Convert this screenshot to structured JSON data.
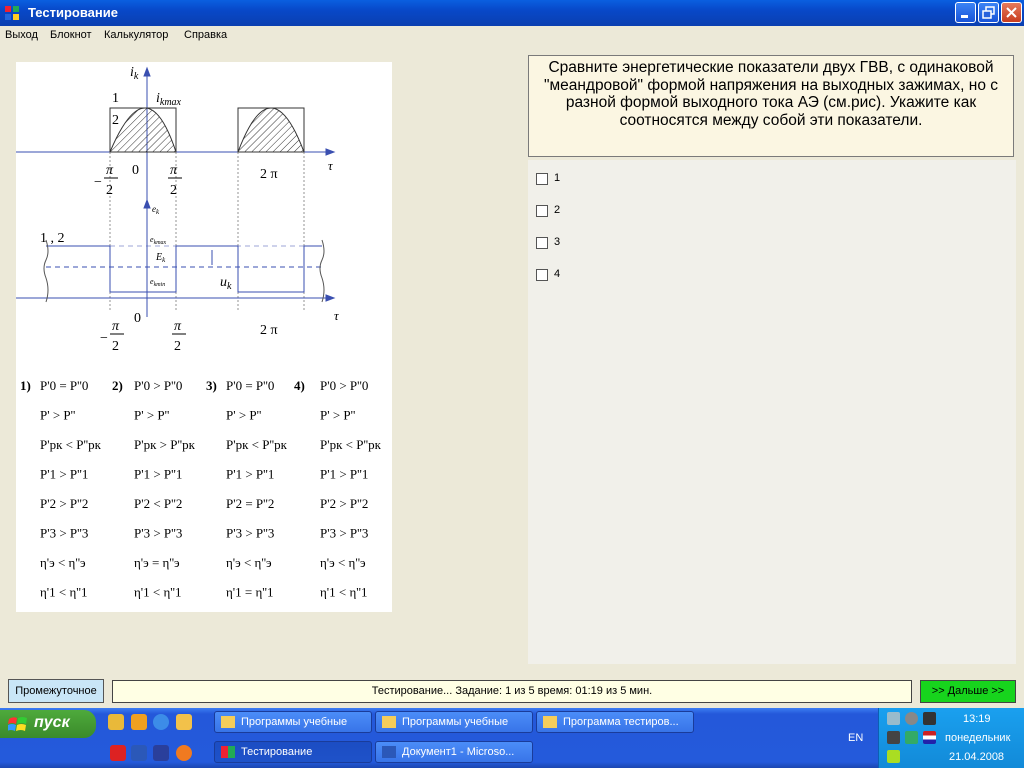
{
  "window": {
    "title": "Тестирование"
  },
  "menu": [
    "Выход",
    "Блокнот",
    "Калькулятор",
    "Справка"
  ],
  "question": "Сравните энергетические показатели двух ГВВ, с одинаковой \"меандровой\" формой напряжения на выходных зажимах, но с разной формой выходного тока АЭ (см.рис). Укажите как соотносятся между собой эти показатели.",
  "answers": [
    "1",
    "2",
    "3",
    "4"
  ],
  "figure": {
    "ik": "i",
    "ik_sub": "k",
    "ikmax": "i",
    "ikmax_sub": "kmax",
    "curve1": "1",
    "curve2": "2",
    "zero": "0",
    "tau": "τ",
    "two_pi": "2 π",
    "pi": "π",
    "two": "2",
    "minus": "−",
    "ek": "e",
    "ek_sub": "k",
    "ekmax": "e",
    "ekmax_sub": "kmax",
    "Ek": "E",
    "Ek_sub": "k",
    "ekmin": "e",
    "ekmin_sub": "kmin",
    "uk": "u",
    "uk_sub": "k",
    "curves12": "1 , 2",
    "relations": [
      {
        "num": "1)",
        "rows": [
          "P'0 = P''0",
          "P' > P''",
          "P'рк < P''рк",
          "P'1 > P''1",
          "P'2 > P''2",
          "P'3 > P''3",
          "η'э < η''э",
          "η'1 < η''1"
        ]
      },
      {
        "num": "2)",
        "rows": [
          "P'0 > P''0",
          "P' > P''",
          "P'рк > P''рк",
          "P'1 > P''1",
          "P'2 < P''2",
          "P'3 > P''3",
          "η'э = η''э",
          "η'1 < η''1"
        ]
      },
      {
        "num": "3)",
        "rows": [
          "P'0 = P''0",
          "P' > P''",
          "P'рк < P''рк",
          "P'1 > P''1",
          "P'2 = P''2",
          "P'3 > P''3",
          "η'э < η''э",
          "η'1 = η''1"
        ]
      },
      {
        "num": "4)",
        "rows": [
          "P'0 > P''0",
          "P' > P''",
          "P'рк < P''рк",
          "P'1 > P''1",
          "P'2 > P''2",
          "P'3 > P''3",
          "η'э < η''э",
          "η'1 < η''1"
        ]
      }
    ]
  },
  "bottom": {
    "intermediate_label": "Промежуточное",
    "status": "Тестирование... Задание: 1 из 5 время: 01:19 из 5 мин.",
    "next_label": ">> Дальше >>"
  },
  "taskbar": {
    "start": "пуск",
    "tasks_top": [
      "Программы учебные",
      "Программы учебные",
      "Программа тестиров..."
    ],
    "tasks_bottom": [
      "Тестирование",
      "Документ1 - Microso..."
    ],
    "lang": "EN",
    "time": "13:19",
    "day": "понедельник",
    "date": "21.04.2008"
  },
  "colors": {
    "next_button": "#17d41d",
    "status_bg": "#ffffe4",
    "question_bg": "#fbf6e2"
  }
}
